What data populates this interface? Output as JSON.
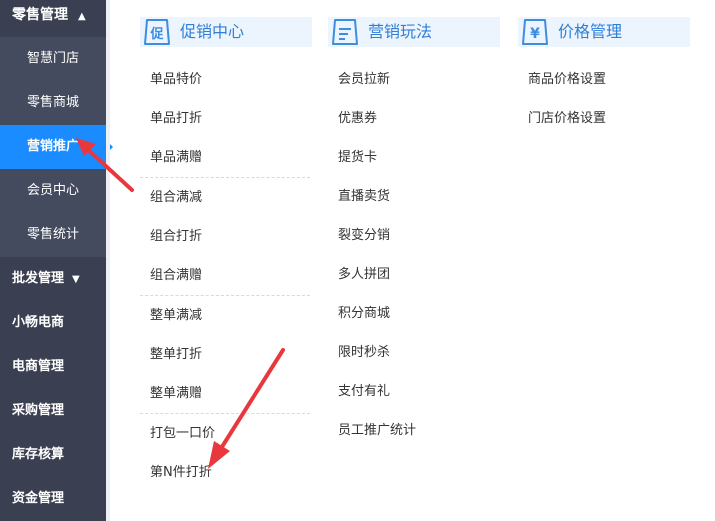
{
  "sidebar": {
    "retail_section": {
      "label": "零售管理",
      "caret": "▲"
    },
    "retail_items": [
      {
        "label": "智慧门店"
      },
      {
        "label": "零售商城"
      },
      {
        "label": "营销推广"
      },
      {
        "label": "会员中心"
      },
      {
        "label": "零售统计"
      }
    ],
    "wholesale": {
      "label": "批发管理",
      "caret": "▼"
    },
    "top_items": [
      {
        "label": "小畅电商"
      },
      {
        "label": "电商管理"
      },
      {
        "label": "采购管理"
      },
      {
        "label": "库存核算"
      },
      {
        "label": "资金管理"
      }
    ]
  },
  "columns": [
    {
      "title": "促销中心",
      "icon": "promotion-icon",
      "links": [
        "单品特价",
        "单品打折",
        "单品满赠",
        "组合满减",
        "组合打折",
        "组合满赠",
        "整单满减",
        "整单打折",
        "整单满赠",
        "打包一口价",
        "第N件打折"
      ]
    },
    {
      "title": "营销玩法",
      "icon": "marketing-icon",
      "links": [
        "会员拉新",
        "优惠券",
        "提货卡",
        "直播卖货",
        "裂变分销",
        "多人拼团",
        "积分商城",
        "限时秒杀",
        "支付有礼",
        "员工推广统计"
      ]
    },
    {
      "title": "价格管理",
      "icon": "price-icon",
      "links": [
        "商品价格设置",
        "门店价格设置"
      ]
    }
  ],
  "colors": {
    "accent": "#1a8cff",
    "sidebar": "#3a3f51",
    "sidebar_sub": "#454b5e",
    "header_bg": "#ecf4fd",
    "header_text": "#2f7fd8",
    "annotation": "#e8383d"
  }
}
